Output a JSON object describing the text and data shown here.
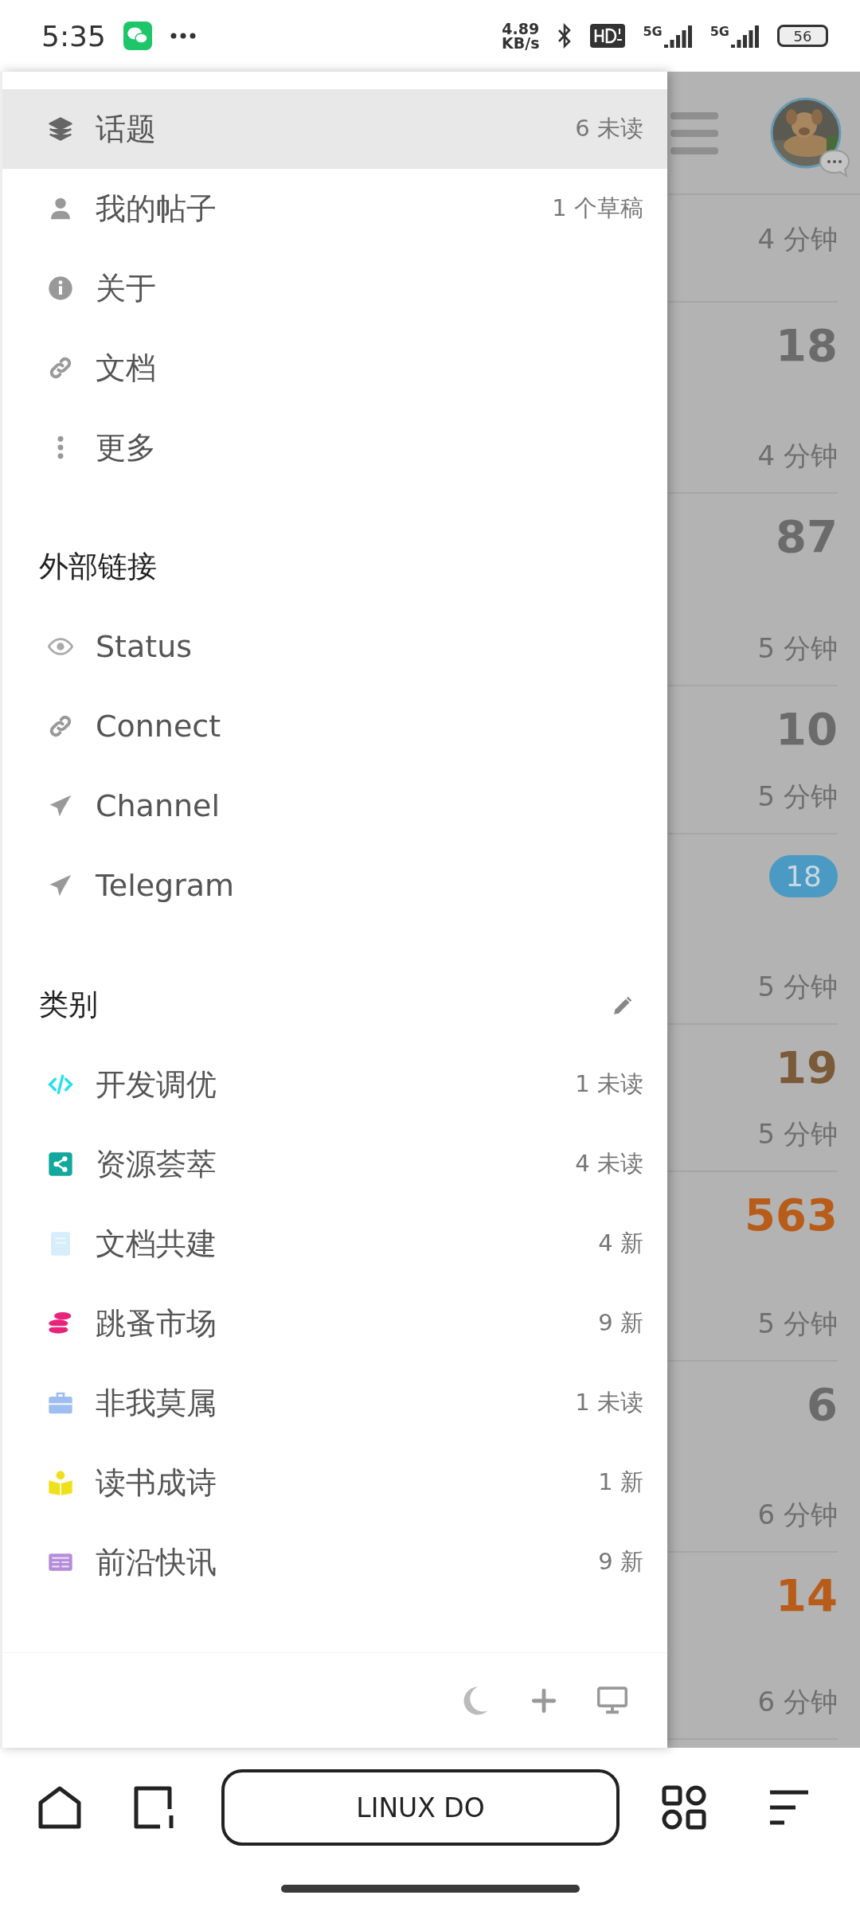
{
  "status_bar": {
    "time": "5:35",
    "network_speed": "4.89",
    "network_unit": "KB/s",
    "signal_labels": [
      "5G",
      "5G"
    ],
    "battery": "56"
  },
  "drawer": {
    "items": [
      {
        "kind": "layers",
        "label": "话题",
        "count": "6 未读",
        "selected": true
      },
      {
        "kind": "user",
        "label": "我的帖子",
        "count": "1 个草稿",
        "selected": false
      },
      {
        "kind": "info",
        "label": "关于",
        "selected": false
      },
      {
        "kind": "link",
        "label": "文档",
        "selected": false
      },
      {
        "kind": "dots",
        "label": "更多",
        "selected": false
      }
    ],
    "external_links": {
      "title": "外部链接",
      "items": [
        {
          "kind": "eye",
          "label": "Status"
        },
        {
          "kind": "link",
          "label": "Connect"
        },
        {
          "kind": "plane",
          "label": "Channel"
        },
        {
          "kind": "plane",
          "label": "Telegram"
        }
      ]
    },
    "categories": {
      "title": "类别",
      "items": [
        {
          "kind": "code",
          "label": "开发调优",
          "count": "1 未读",
          "color": "#25e0f0"
        },
        {
          "kind": "share",
          "label": "资源荟萃",
          "count": "4 未读",
          "color": "#12a89d"
        },
        {
          "kind": "book",
          "label": "文档共建",
          "count": "4 新",
          "color": "#d6eef9"
        },
        {
          "kind": "coins",
          "label": "跳蚤市场",
          "count": "9 新",
          "color": "#e8237a"
        },
        {
          "kind": "briefcase",
          "label": "非我莫属",
          "count": "1 未读",
          "color": "#9fbef0"
        },
        {
          "kind": "reader",
          "label": "读书成诗",
          "count": "1 新",
          "color": "#efe01a"
        },
        {
          "kind": "news",
          "label": "前沿快讯",
          "count": "9 新",
          "color": "#b48cd8"
        }
      ]
    }
  },
  "feed": {
    "rows": [
      {
        "kind": "time",
        "time": "4 分钟"
      },
      {
        "kind": "count",
        "count": "18",
        "color": "#6b6b6b",
        "time": "4 分钟"
      },
      {
        "kind": "count",
        "count": "87",
        "color": "#6b6b6b",
        "time": "5 分钟"
      },
      {
        "kind": "count",
        "count": "10",
        "color": "#6b6b6b",
        "time": "5 分钟"
      },
      {
        "kind": "badge",
        "count": "18",
        "time": "5 分钟"
      },
      {
        "kind": "count",
        "count": "19",
        "color": "#7a5a38",
        "time": "5 分钟"
      },
      {
        "kind": "count",
        "count": "563",
        "color": "#b85c1a",
        "time": "5 分钟"
      },
      {
        "kind": "count",
        "count": "6",
        "color": "#6b6b6b",
        "time": "6 分钟"
      },
      {
        "kind": "count",
        "count": "14",
        "color": "#b85c1a",
        "time": "6 分钟"
      }
    ]
  },
  "bottom_nav": {
    "title": "LINUX DO"
  }
}
